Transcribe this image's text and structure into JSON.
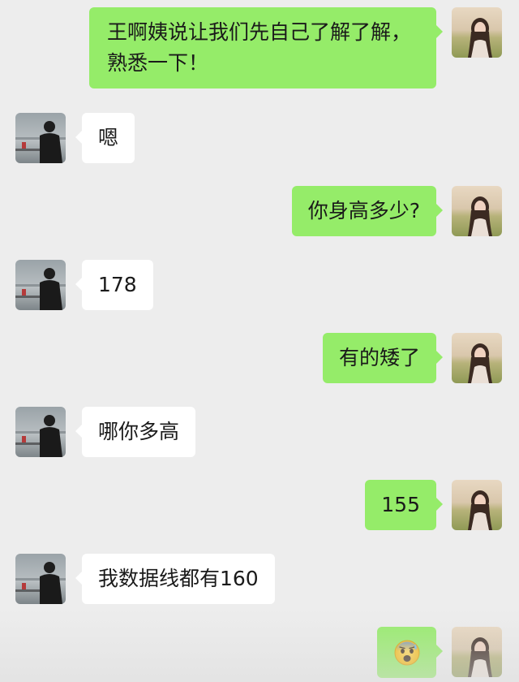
{
  "messages": [
    {
      "side": "out",
      "text": "王啊姨说让我们先自己了解了解，熟悉一下！"
    },
    {
      "side": "in",
      "text": "嗯"
    },
    {
      "side": "out",
      "text": "你身高多少?"
    },
    {
      "side": "in",
      "text": "178"
    },
    {
      "side": "out",
      "text": "有的矮了"
    },
    {
      "side": "in",
      "text": "哪你多高"
    },
    {
      "side": "out",
      "text": "155"
    },
    {
      "side": "in",
      "text": "我数据线都有160"
    },
    {
      "side": "out",
      "emoji": "anxious-face-with-sweat"
    }
  ],
  "colors": {
    "background": "#ededed",
    "outgoing_bubble": "#95ec69",
    "incoming_bubble": "#ffffff",
    "text": "#1a1a1a"
  },
  "icons": {
    "incoming_avatar": "man-silhouette-by-sea-avatar",
    "outgoing_avatar": "woman-portrait-in-field-avatar",
    "emoji": "anxious-face-with-sweat-icon"
  }
}
